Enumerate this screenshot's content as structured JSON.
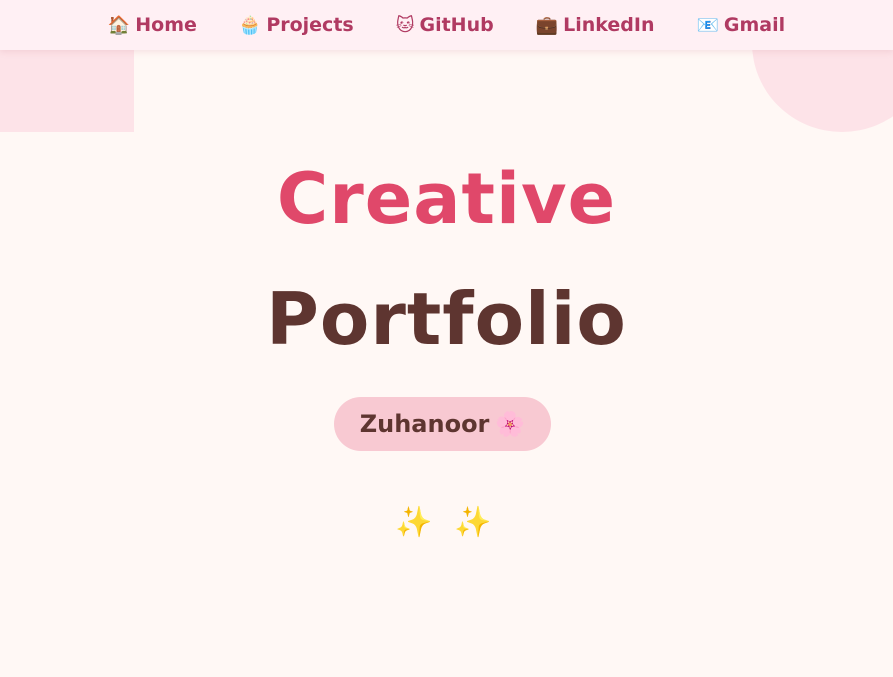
{
  "nav": {
    "items": [
      {
        "icon": "🏠",
        "label": "Home"
      },
      {
        "icon": "🧁",
        "label": "Projects"
      },
      {
        "icon": "🐱",
        "label": "GitHub"
      },
      {
        "icon": "💼",
        "label": "LinkedIn"
      },
      {
        "icon": "📧",
        "label": "Gmail"
      }
    ]
  },
  "hero": {
    "title_line1": "Creative",
    "title_line2": "Portfolio",
    "name": "Zuhanoor",
    "name_emoji": "🌸",
    "sparkles": "✨ ✨"
  },
  "colors": {
    "background": "#fff8f5",
    "nav_background": "#fff0f4",
    "nav_text": "#b03a62",
    "accent_pink": "#e0486a",
    "brown": "#5e3530",
    "badge": "#f8c9d2",
    "decor": "#fde3e8"
  }
}
